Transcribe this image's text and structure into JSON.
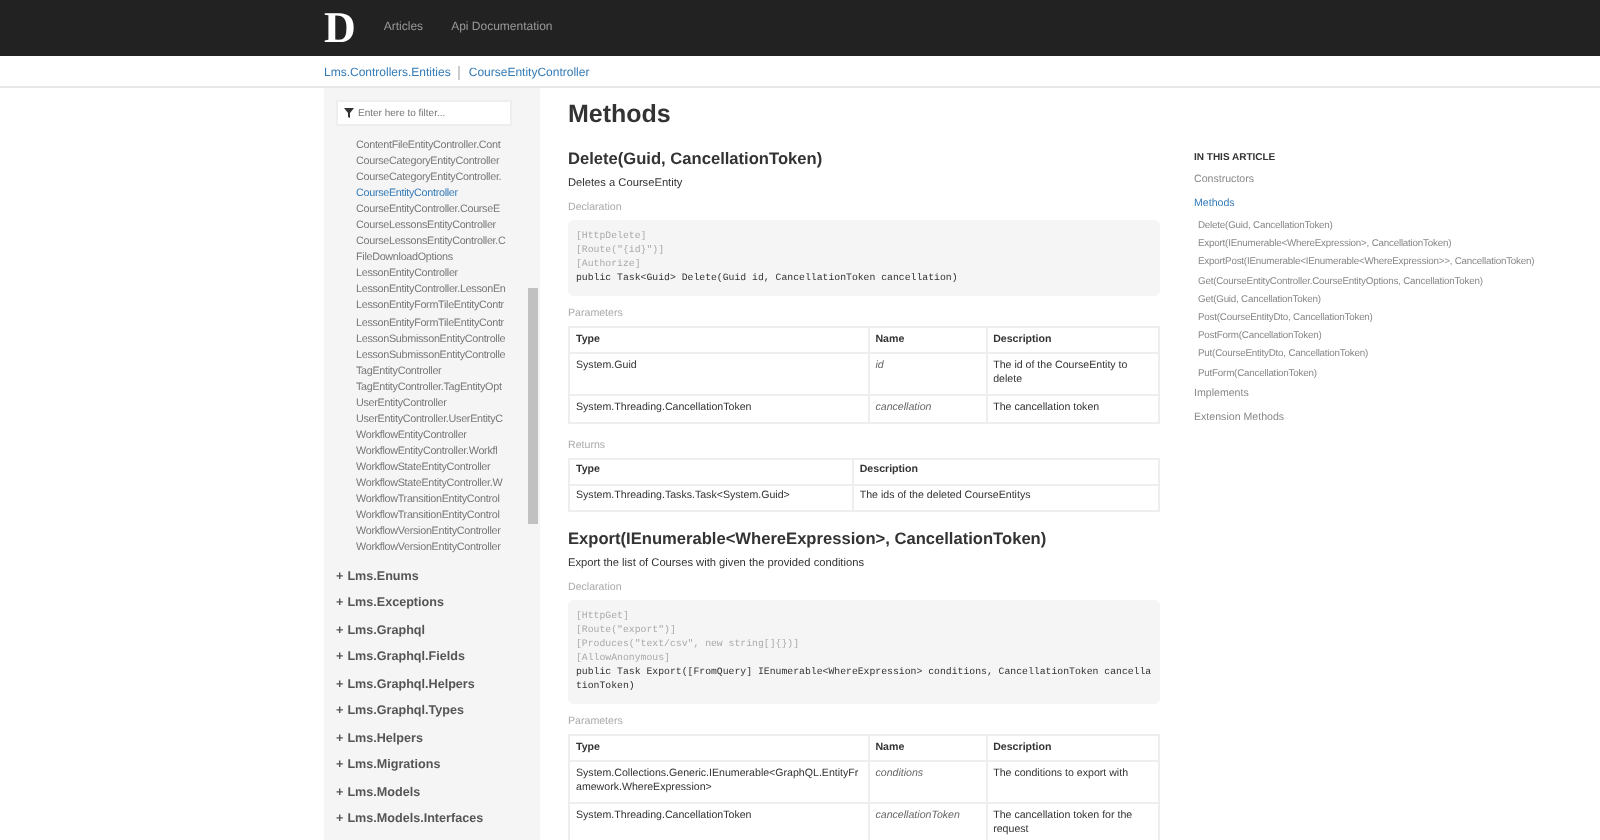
{
  "navbar": {
    "logo": "D",
    "links": [
      "Articles",
      "Api Documentation"
    ]
  },
  "breadcrumb": [
    "Lms.Controllers.Entities",
    "CourseEntityController"
  ],
  "sidebar": {
    "filter": {
      "placeholder": "Enter here to filter..."
    },
    "classes": [
      {
        "label": "ContentFileEntityController.Cont",
        "selected": false
      },
      {
        "label": "CourseCategoryEntityController",
        "selected": false
      },
      {
        "label": "CourseCategoryEntityController.",
        "selected": false
      },
      {
        "label": "CourseEntityController",
        "selected": true
      },
      {
        "label": "CourseEntityController.CourseE",
        "selected": false
      },
      {
        "label": "CourseLessonsEntityController",
        "selected": false
      },
      {
        "label": "CourseLessonsEntityController.C",
        "selected": false
      },
      {
        "label": "FileDownloadOptions",
        "selected": false
      },
      {
        "label": "LessonEntityController",
        "selected": false
      },
      {
        "label": "LessonEntityController.LessonEn",
        "selected": false
      },
      {
        "label": "LessonEntityFormTileEntityContr",
        "selected": false
      },
      {
        "label": "LessonEntityFormTileEntityContr",
        "selected": false
      },
      {
        "label": "LessonSubmissonEntityControlle",
        "selected": false
      },
      {
        "label": "LessonSubmissonEntityControlle",
        "selected": false
      },
      {
        "label": "TagEntityController",
        "selected": false
      },
      {
        "label": "TagEntityController.TagEntityOpt",
        "selected": false
      },
      {
        "label": "UserEntityController",
        "selected": false
      },
      {
        "label": "UserEntityController.UserEntityC",
        "selected": false
      },
      {
        "label": "WorkflowEntityController",
        "selected": false
      },
      {
        "label": "WorkflowEntityController.Workfl",
        "selected": false
      },
      {
        "label": "WorkflowStateEntityController",
        "selected": false
      },
      {
        "label": "WorkflowStateEntityController.W",
        "selected": false
      },
      {
        "label": "WorkflowTransitionEntityControl",
        "selected": false
      },
      {
        "label": "WorkflowTransitionEntityControl",
        "selected": false
      },
      {
        "label": "WorkflowVersionEntityController",
        "selected": false
      },
      {
        "label": "WorkflowVersionEntityController",
        "selected": false
      }
    ],
    "namespaces": [
      {
        "toggle": "+",
        "label": "Lms.Enums"
      },
      {
        "toggle": "+",
        "label": "Lms.Exceptions"
      },
      {
        "toggle": "+",
        "label": "Lms.Graphql"
      },
      {
        "toggle": "+",
        "label": "Lms.Graphql.Fields"
      },
      {
        "toggle": "+",
        "label": "Lms.Graphql.Helpers"
      },
      {
        "toggle": "+",
        "label": "Lms.Graphql.Types"
      },
      {
        "toggle": "+",
        "label": "Lms.Helpers"
      },
      {
        "toggle": "+",
        "label": "Lms.Migrations"
      },
      {
        "toggle": "+",
        "label": "Lms.Models"
      },
      {
        "toggle": "+",
        "label": "Lms.Models.Interfaces"
      }
    ]
  },
  "main": {
    "title": "Methods",
    "methods": [
      {
        "heading": "Delete(Guid, CancellationToken)",
        "summary": "Deletes a CourseEntity",
        "declaration_label": "Declaration",
        "code": [
          {
            "kind": "attribute",
            "text": "[HttpDelete]"
          },
          {
            "kind": "attribute",
            "text": "[Route(\"{id}\")]"
          },
          {
            "kind": "attribute",
            "text": "[Authorize]"
          },
          {
            "kind": "signature",
            "text": "public Task<Guid> Delete(Guid id, CancellationToken cancellation)"
          }
        ],
        "tables": [
          {
            "label": "Parameters",
            "columns": [
              "Type",
              "Name",
              "Description"
            ],
            "rows": [
              [
                "System.Guid",
                "id",
                "The id of the CourseEntity to delete"
              ],
              [
                "System.Threading.CancellationToken",
                "cancellation",
                "The cancellation token"
              ]
            ]
          },
          {
            "label": "Returns",
            "columns": [
              "Type",
              "Description"
            ],
            "rows": [
              [
                "System.Threading.Tasks.Task<System.Guid>",
                "The ids of the deleted CourseEntitys"
              ]
            ]
          }
        ]
      },
      {
        "heading": "Export(IEnumerable<WhereExpression>, CancellationToken)",
        "summary": "Export the list of Courses with given the provided conditions",
        "declaration_label": "Declaration",
        "code": [
          {
            "kind": "attribute",
            "text": "[HttpGet]"
          },
          {
            "kind": "attribute",
            "text": "[Route(\"export\")]"
          },
          {
            "kind": "attribute",
            "text": "[Produces(\"text/csv\", new string[]{})]"
          },
          {
            "kind": "attribute",
            "text": "[AllowAnonymous]"
          },
          {
            "kind": "signature",
            "text": "public Task Export([FromQuery] IEnumerable<WhereExpression> conditions, CancellationToken cancellationToken)"
          }
        ],
        "tables": [
          {
            "label": "Parameters",
            "columns": [
              "Type",
              "Name",
              "Description"
            ],
            "rows": [
              [
                "System.Collections.Generic.IEnumerable<GraphQL.EntityFramework.WhereExpression>",
                "conditions",
                "The conditions to export with"
              ],
              [
                "System.Threading.CancellationToken",
                "cancellationToken",
                "The cancellation token for the request"
              ]
            ]
          }
        ]
      }
    ]
  },
  "toc": {
    "title": "IN THIS ARTICLE",
    "items": [
      {
        "label": "Constructors",
        "selected": false
      },
      {
        "label": "Methods",
        "selected": true,
        "children": [
          "Delete(Guid, CancellationToken)",
          "Export(IEnumerable<WhereExpression>, CancellationToken)",
          "ExportPost(IEnumerable<IEnumerable<WhereExpression>>, CancellationToken)",
          "Get(CourseEntityController.CourseEntityOptions, CancellationToken)",
          "Get(Guid, CancellationToken)",
          "Post(CourseEntityDto, CancellationToken)",
          "PostForm(CancellationToken)",
          "Put(CourseEntityDto, CancellationToken)",
          "PutForm(CancellationToken)"
        ]
      },
      {
        "label": "Implements",
        "selected": false
      },
      {
        "label": "Extension Methods",
        "selected": false
      }
    ]
  }
}
